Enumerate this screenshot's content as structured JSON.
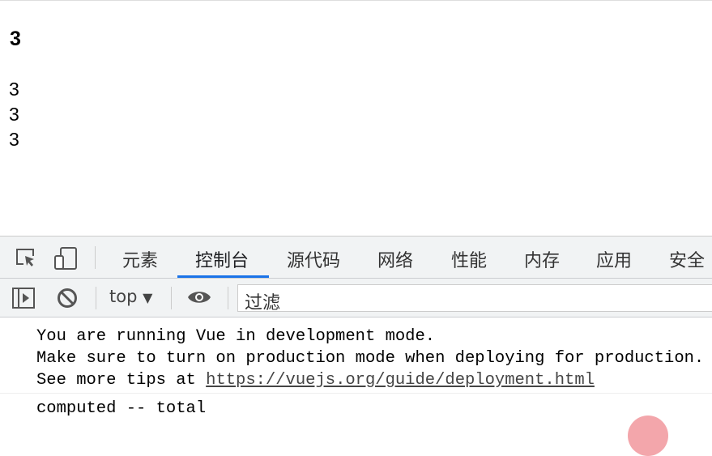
{
  "page": {
    "heading": "3",
    "lines": [
      "3",
      "3",
      "3"
    ]
  },
  "devtools": {
    "tabs": [
      "元素",
      "控制台",
      "源代码",
      "网络",
      "性能",
      "内存",
      "应用",
      "安全"
    ],
    "active_tab": "控制台",
    "context": "top",
    "filter_placeholder": "过滤",
    "console": {
      "messages": [
        "You are running Vue in development mode.",
        "Make sure to turn on production mode when deploying for production.",
        "See more tips at "
      ],
      "link": "https://vuejs.org/guide/deployment.html",
      "log": "computed -- total"
    },
    "accent": "#1a73e8"
  }
}
